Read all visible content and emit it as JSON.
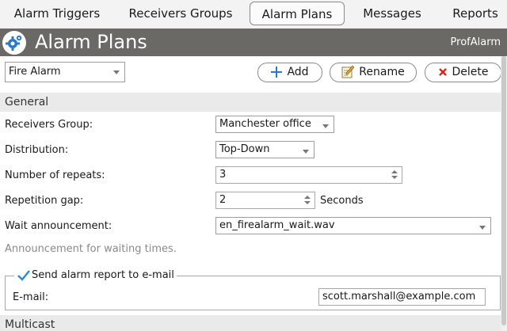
{
  "tabs": [
    {
      "label": "Alarm Triggers"
    },
    {
      "label": "Receivers Groups"
    },
    {
      "label": "Alarm Plans"
    },
    {
      "label": "Messages"
    },
    {
      "label": "Reports"
    }
  ],
  "active_tab": "Alarm Plans",
  "header": {
    "title": "Alarm Plans",
    "brand": "ProfAlarm",
    "logo_icon": "gear-icon"
  },
  "toolbar": {
    "plan_selected": "Fire Alarm",
    "add_label": "Add",
    "rename_label": "Rename",
    "delete_label": "Delete"
  },
  "general": {
    "section_title": "General",
    "receivers_group_label": "Receivers Group:",
    "receivers_group_value": "Manchester office",
    "distribution_label": "Distribution:",
    "distribution_value": "Top-Down",
    "repeats_label": "Number of repeats:",
    "repeats_value": "3",
    "gap_label": "Repetition gap:",
    "gap_value": "2",
    "gap_unit": "Seconds",
    "wait_label": "Wait announcement:",
    "wait_value": "en_firealarm_wait.wav",
    "wait_hint": "Announcement for waiting times."
  },
  "email_report": {
    "legend": "Send alarm report to e-mail",
    "checked": true,
    "email_label": "E-mail:",
    "email_value": "scott.marshall@example.com"
  },
  "multicast": {
    "section_title": "Multicast"
  },
  "colors": {
    "header_bg": "#6a6966",
    "add_icon": "#2a78c8",
    "delete_icon": "#d9261c",
    "check": "#2a8ad8"
  }
}
